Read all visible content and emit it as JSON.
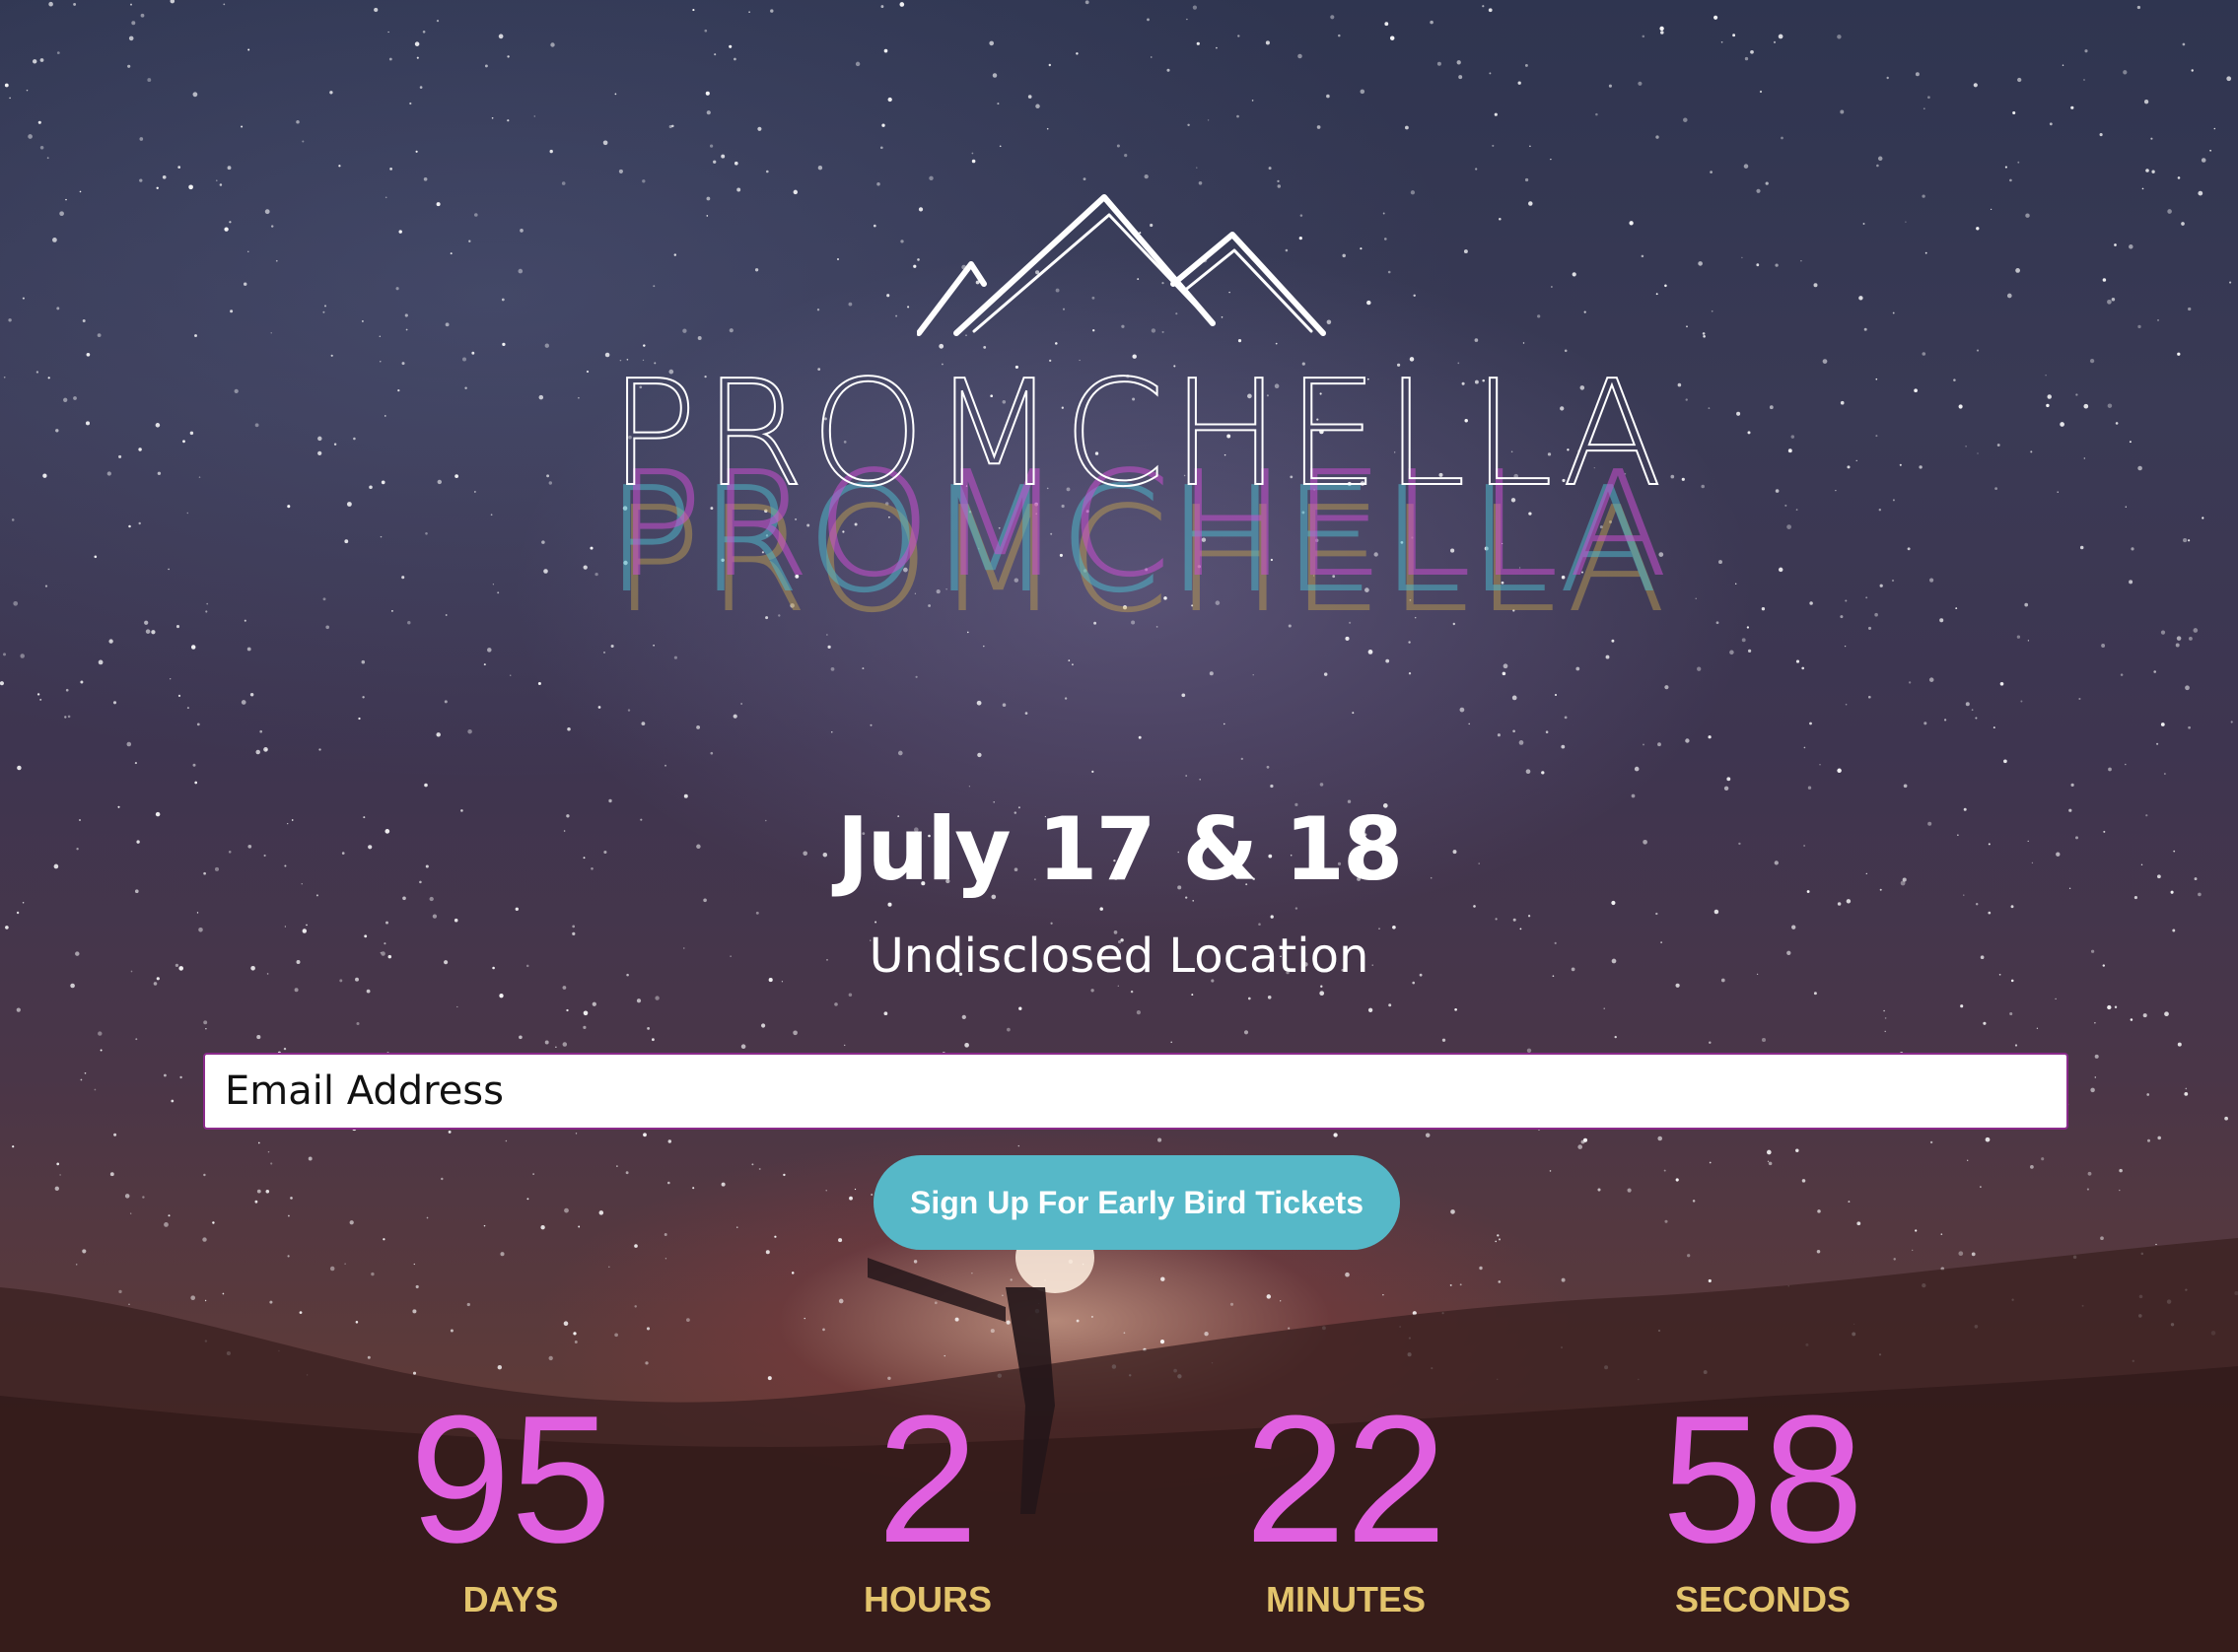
{
  "logo": {
    "text": "PROMCHELLA",
    "colors": {
      "main": "#ffffff",
      "echo_magenta": "#c84fd0",
      "echo_cyan": "#4fb5c8",
      "echo_gold": "#c8a64f"
    }
  },
  "event": {
    "date": "July 17 & 18",
    "location": "Undisclosed Location"
  },
  "signup": {
    "email_placeholder": "Email Address",
    "button_label": "Sign Up For Early Bird Tickets",
    "button_color": "#56b8c8"
  },
  "countdown": {
    "number_color": "#e060e0",
    "label_color": "#e3c46c",
    "units": [
      {
        "value": "95",
        "label": "DAYS"
      },
      {
        "value": "2",
        "label": "HOURS"
      },
      {
        "value": "22",
        "label": "MINUTES"
      },
      {
        "value": "58",
        "label": "SECONDS"
      }
    ]
  }
}
